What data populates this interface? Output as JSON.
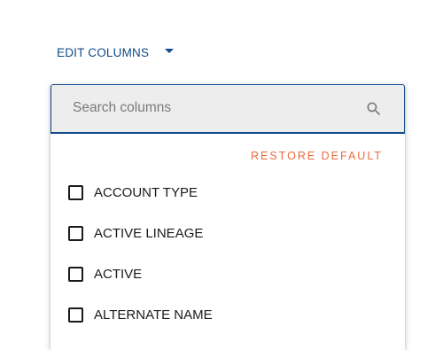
{
  "header": {
    "edit_columns_label": "EDIT COLUMNS",
    "caret_icon": "caret-down-icon",
    "accent_color": "#0f4a8a"
  },
  "dropdown": {
    "search": {
      "placeholder": "Search columns",
      "value": "",
      "icon": "search-icon"
    },
    "restore_default_label": "RESTORE DEFAULT",
    "restore_default_color": "#ec6a3c",
    "columns": [
      {
        "label": "ACCOUNT TYPE",
        "checked": false
      },
      {
        "label": "ACTIVE LINEAGE",
        "checked": false
      },
      {
        "label": "ACTIVE",
        "checked": false
      },
      {
        "label": "ALTERNATE NAME",
        "checked": false
      }
    ]
  }
}
